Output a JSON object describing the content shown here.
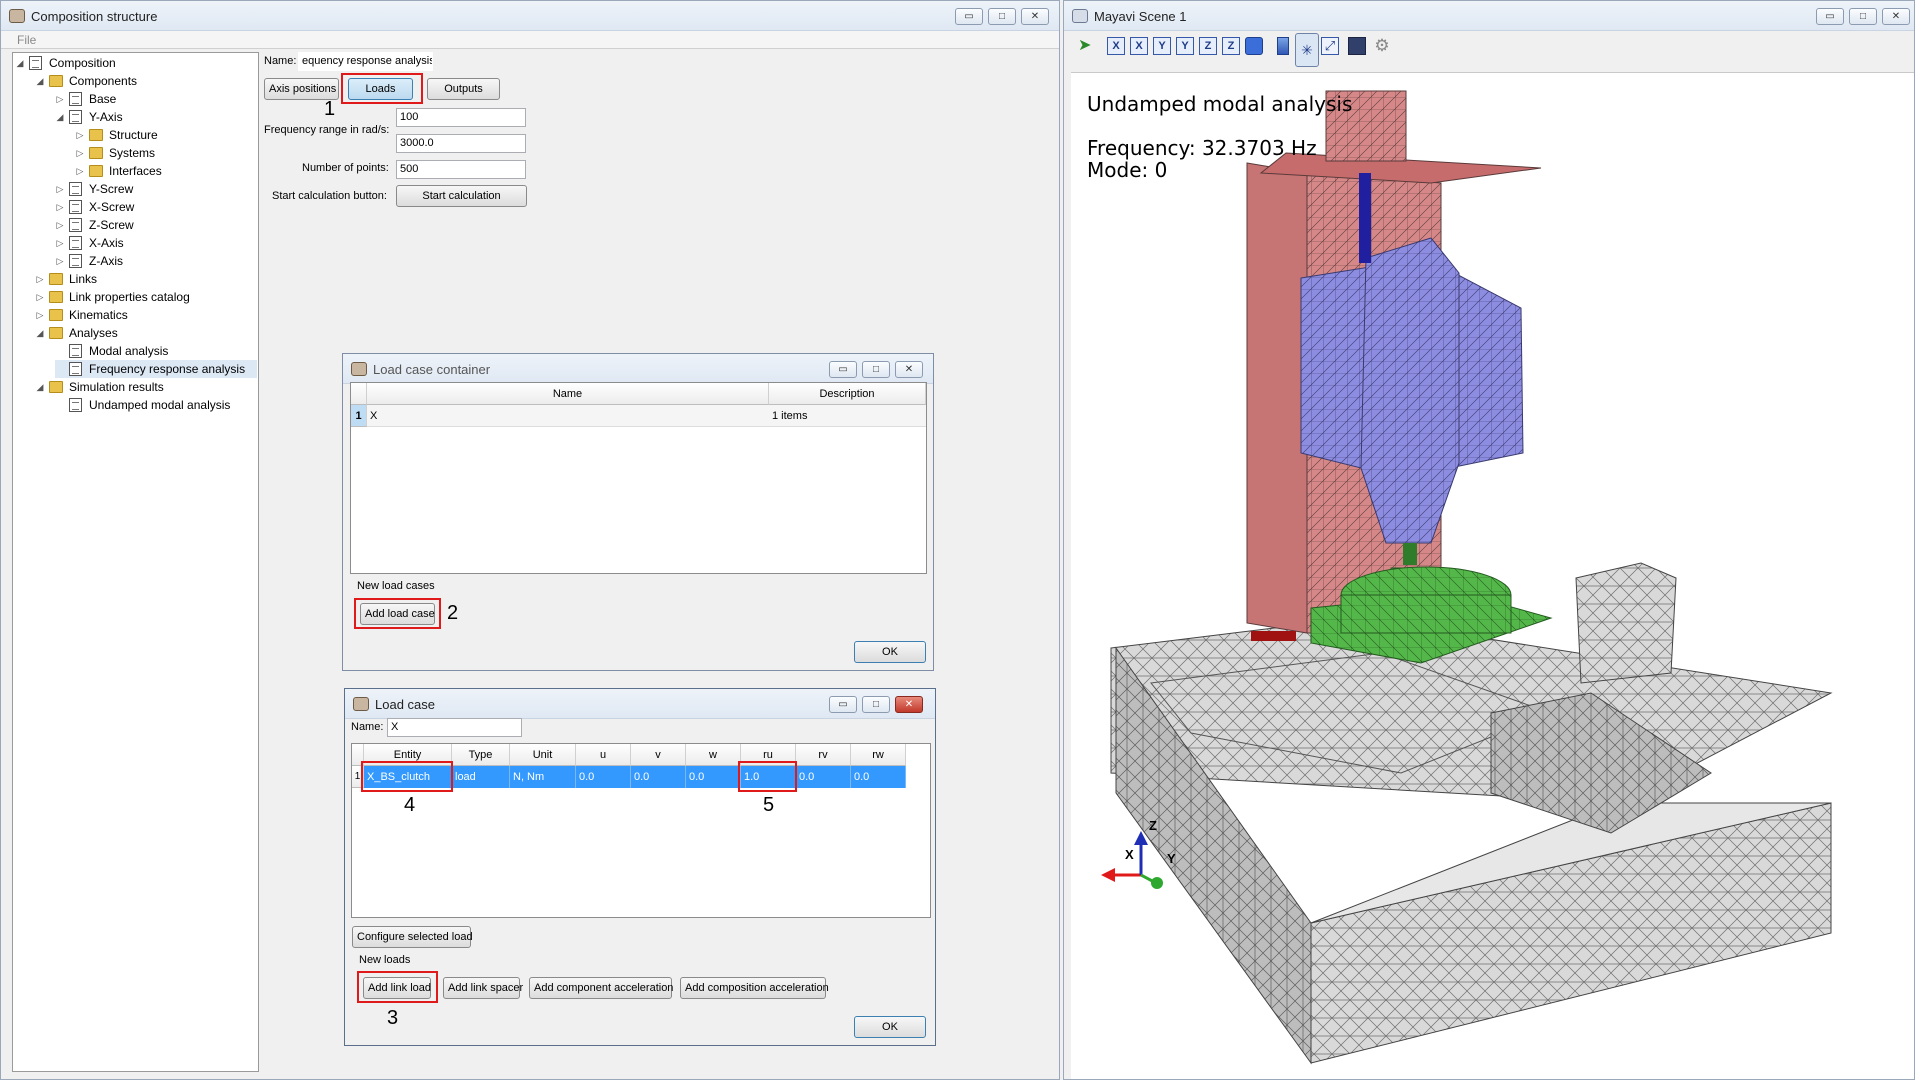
{
  "left_window": {
    "title": "Composition structure",
    "menu": "File",
    "buttons": {
      "minimize": "▭",
      "maximize": "□",
      "close": "✕"
    }
  },
  "tree": [
    {
      "label": "Composition",
      "level": 0,
      "icon": "document-icon",
      "expanded": true
    },
    {
      "label": "Components",
      "level": 1,
      "icon": "folder-icon",
      "expanded": true
    },
    {
      "label": "Base",
      "level": 2,
      "icon": "document-icon",
      "expanded": false
    },
    {
      "label": "Y-Axis",
      "level": 2,
      "icon": "document-icon",
      "expanded": true
    },
    {
      "label": "Structure",
      "level": 3,
      "icon": "folder-icon",
      "expanded": false
    },
    {
      "label": "Systems",
      "level": 3,
      "icon": "folder-icon",
      "expanded": false
    },
    {
      "label": "Interfaces",
      "level": 3,
      "icon": "folder-icon",
      "expanded": false
    },
    {
      "label": "Y-Screw",
      "level": 2,
      "icon": "document-icon",
      "expanded": false
    },
    {
      "label": "X-Screw",
      "level": 2,
      "icon": "document-icon",
      "expanded": false
    },
    {
      "label": "Z-Screw",
      "level": 2,
      "icon": "document-icon",
      "expanded": false
    },
    {
      "label": "X-Axis",
      "level": 2,
      "icon": "document-icon",
      "expanded": false
    },
    {
      "label": "Z-Axis",
      "level": 2,
      "icon": "document-icon",
      "expanded": false
    },
    {
      "label": "Links",
      "level": 1,
      "icon": "folder-icon",
      "expanded": false
    },
    {
      "label": "Link properties catalog",
      "level": 1,
      "icon": "folder-icon",
      "expanded": false
    },
    {
      "label": "Kinematics",
      "level": 1,
      "icon": "folder-icon",
      "expanded": false
    },
    {
      "label": "Analyses",
      "level": 1,
      "icon": "folder-icon",
      "expanded": true
    },
    {
      "label": "Modal analysis",
      "level": 2,
      "icon": "document-icon",
      "expanded": null
    },
    {
      "label": "Frequency response analysis",
      "level": 2,
      "icon": "document-icon",
      "expanded": null,
      "selected": true
    },
    {
      "label": "Simulation results",
      "level": 1,
      "icon": "folder-icon",
      "expanded": true
    },
    {
      "label": "Undamped modal analysis",
      "level": 2,
      "icon": "document-icon",
      "expanded": null
    }
  ],
  "analysis_panel": {
    "name_label": "Name:",
    "name_value": "equency response analysis",
    "tab_axis_positions": "Axis positions",
    "tab_loads": "Loads",
    "tab_outputs": "Outputs",
    "freq_range_label": "Frequency range in rad/s:",
    "freq_min": "100",
    "freq_max": "3000.0",
    "num_points_label": "Number of points:",
    "num_points": "500",
    "start_label": "Start calculation button:",
    "start_button": "Start calculation"
  },
  "annotations": [
    "1",
    "2",
    "3",
    "4",
    "5"
  ],
  "load_case_container": {
    "title": "Load case container",
    "columns": [
      "Name",
      "Description"
    ],
    "rows": [
      {
        "index": "1",
        "name": "X",
        "description": "1 items"
      }
    ],
    "new_label": "New load cases",
    "add_button": "Add load case",
    "ok": "OK"
  },
  "load_case": {
    "title": "Load case",
    "name_label": "Name:",
    "name_value": "X",
    "columns": [
      "Entity",
      "Type",
      "Unit",
      "u",
      "v",
      "w",
      "ru",
      "rv",
      "rw"
    ],
    "rows": [
      {
        "index": "1",
        "cells": [
          "X_BS_clutch",
          "load",
          "N, Nm",
          "0.0",
          "0.0",
          "0.0",
          "1.0",
          "0.0",
          "0.0"
        ]
      }
    ],
    "configure_button": "Configure selected load",
    "new_loads_label": "New loads",
    "add_link_load": "Add link load",
    "add_link_spacer": "Add link spacer",
    "add_component_acceleration": "Add component acceleration",
    "add_composition_acceleration": "Add composition acceleration",
    "ok": "OK"
  },
  "mayavi": {
    "title": "Mayavi Scene 1",
    "toolbar": [
      "X",
      "X",
      "Y",
      "Y",
      "Z",
      "Z"
    ],
    "scene_title": "Undamped modal analysis",
    "frequency": "Frequency: 32.3703 Hz",
    "mode": "Mode: 0",
    "axis_x": "X",
    "axis_y": "Y",
    "axis_z": "Z"
  },
  "colors": {
    "annotation_red": "#e01a1a",
    "selection_blue": "#3399ff",
    "mesh_red": "#d98b8b",
    "mesh_blue": "#8f8fe0",
    "mesh_green": "#55b84a",
    "mesh_gray": "#cfcfcf"
  }
}
